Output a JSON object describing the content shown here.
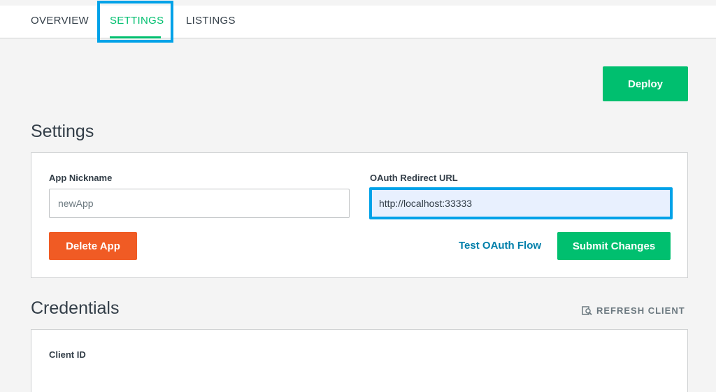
{
  "tabs": {
    "overview": "OVERVIEW",
    "settings": "SETTINGS",
    "listings": "LISTINGS"
  },
  "deploy_label": "Deploy",
  "settings": {
    "title": "Settings",
    "nickname_label": "App Nickname",
    "nickname_value": "newApp",
    "oauth_label": "OAuth Redirect URL",
    "oauth_value": "http://localhost:33333",
    "delete_label": "Delete App",
    "test_link": "Test OAuth Flow",
    "submit_label": "Submit Changes"
  },
  "credentials": {
    "title": "Credentials",
    "refresh_label": "REFRESH CLIENT",
    "client_id_label": "Client ID"
  },
  "colors": {
    "accent_green": "#00bf6f",
    "danger_orange": "#f05b24",
    "link_blue": "#007faa",
    "highlight_blue": "#00a2e8"
  },
  "icons": {
    "refresh": "refresh-client-icon"
  }
}
